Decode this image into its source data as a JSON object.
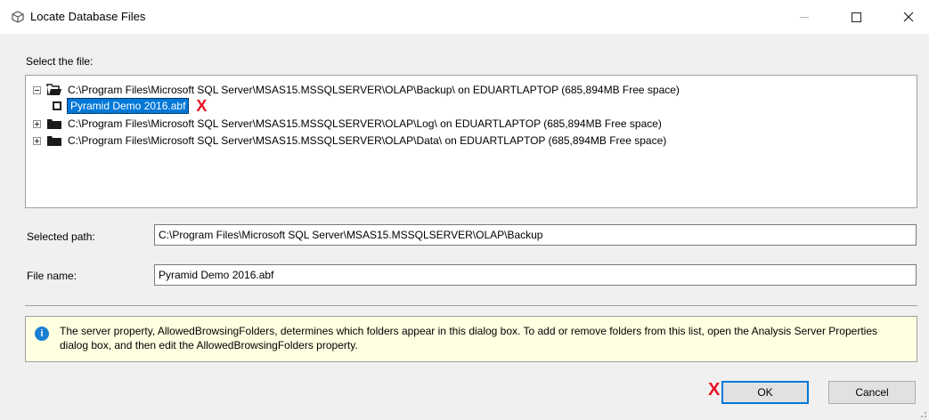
{
  "window": {
    "title": "Locate Database Files",
    "icon": "cube-icon"
  },
  "tree": {
    "label": "Select the file:",
    "items": [
      {
        "expander": "minus",
        "path": "C:\\Program Files\\Microsoft SQL Server\\MSAS15.MSSQLSERVER\\OLAP\\Backup\\ on EDUARTLAPTOP (685,894MB Free space)",
        "children": [
          {
            "name": "Pyramid Demo 2016.abf",
            "selected": true
          }
        ]
      },
      {
        "expander": "plus",
        "path": "C:\\Program Files\\Microsoft SQL Server\\MSAS15.MSSQLSERVER\\OLAP\\Log\\ on EDUARTLAPTOP (685,894MB Free space)"
      },
      {
        "expander": "plus",
        "path": "C:\\Program Files\\Microsoft SQL Server\\MSAS15.MSSQLSERVER\\OLAP\\Data\\ on EDUARTLAPTOP (685,894MB Free space)"
      }
    ]
  },
  "selected_path": {
    "label": "Selected path:",
    "value": "C:\\Program Files\\Microsoft SQL Server\\MSAS15.MSSQLSERVER\\OLAP\\Backup"
  },
  "file_name": {
    "label": "File name:",
    "value": "Pyramid Demo 2016.abf"
  },
  "info": {
    "icon": "info-icon",
    "text": "The server property, AllowedBrowsingFolders, determines which folders appear in this dialog box. To add or remove folders from this list, open the Analysis Server Properties dialog box, and then edit the AllowedBrowsingFolders property."
  },
  "buttons": {
    "ok": "OK",
    "cancel": "Cancel"
  },
  "annotations": {
    "mark_color": "#e81123",
    "mark_glyph": "X"
  }
}
